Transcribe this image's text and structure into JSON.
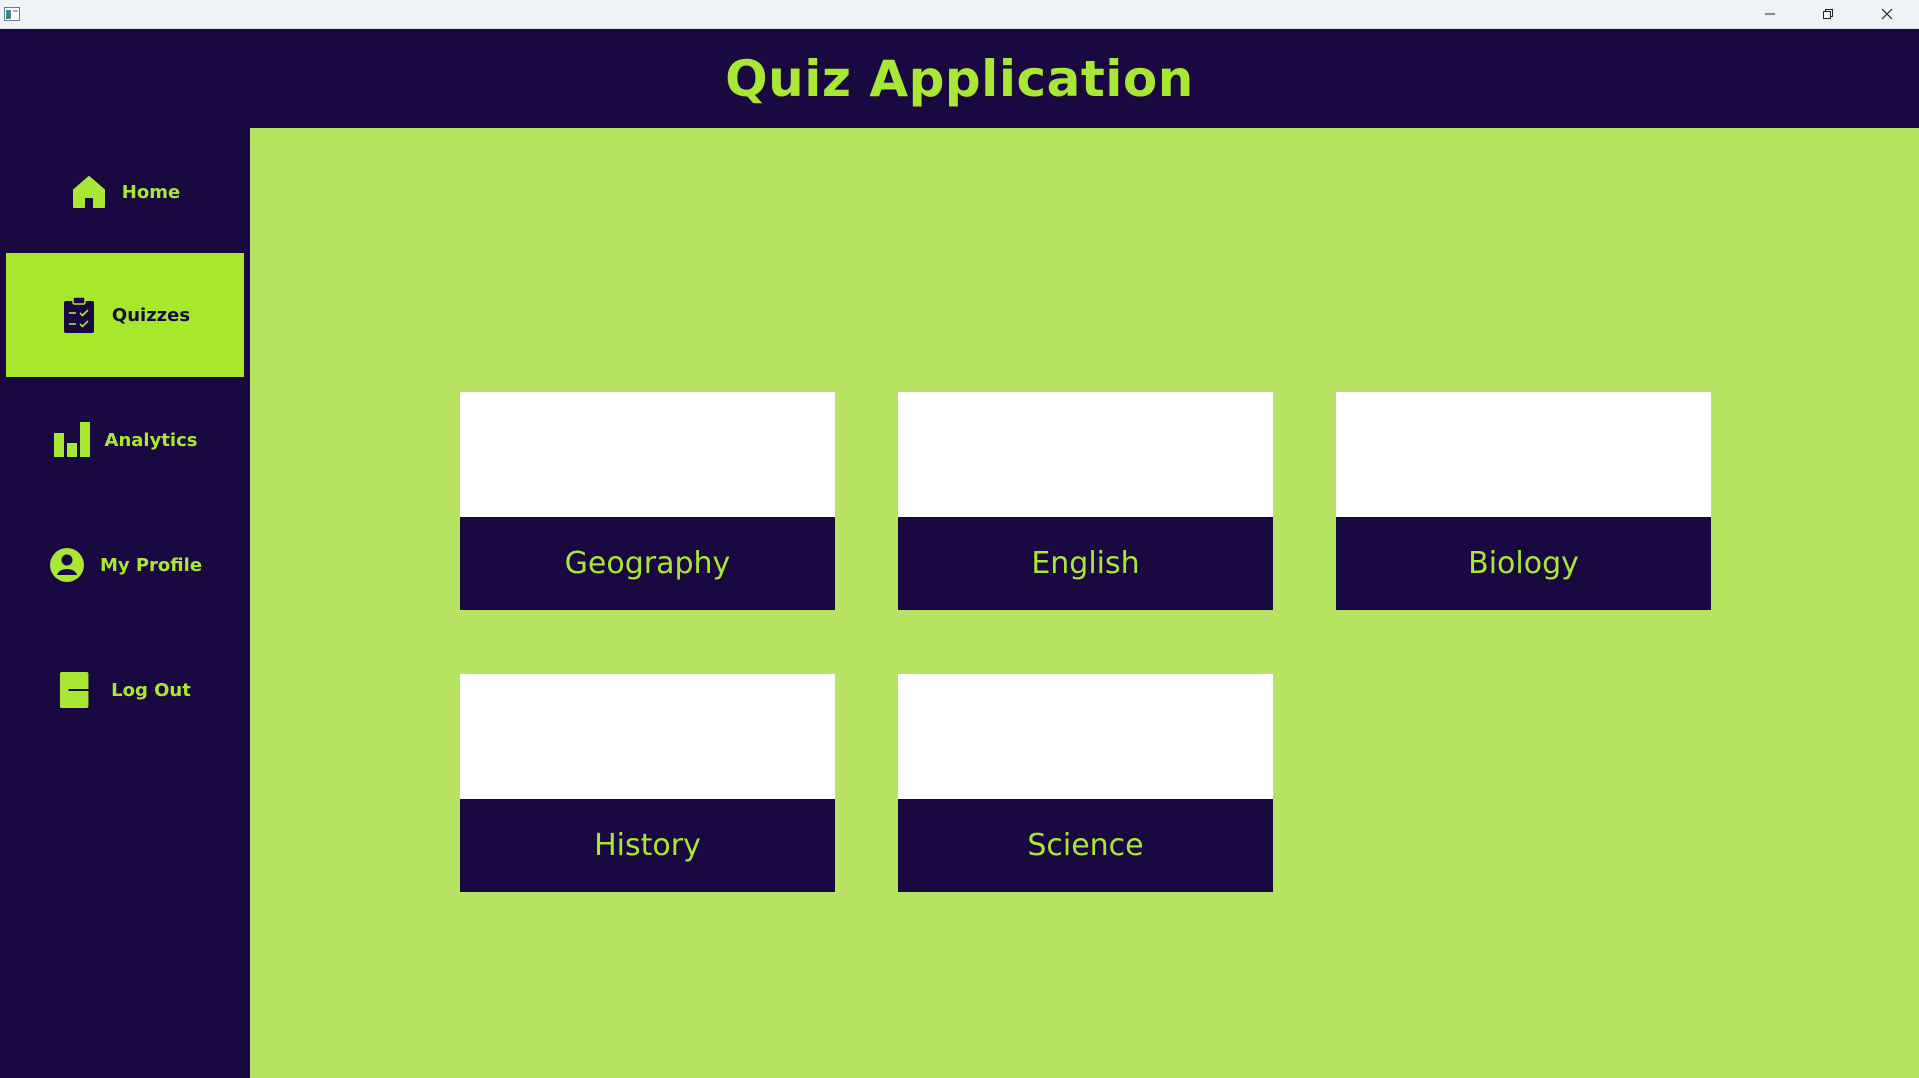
{
  "colors": {
    "dark": "#1a0840",
    "accent": "#a8e834",
    "content_bg": "#b6e462",
    "active_nav_bg": "#a8e82c",
    "card_image_bg": "#ffffff"
  },
  "window": {
    "controls": [
      "minimize",
      "restore",
      "close"
    ]
  },
  "header": {
    "title": "Quiz Application"
  },
  "sidebar": {
    "items": [
      {
        "label": "Home",
        "icon": "home-icon",
        "active": false
      },
      {
        "label": "Quizzes",
        "icon": "clipboard-checklist-icon",
        "active": true
      },
      {
        "label": "Analytics",
        "icon": "bar-chart-icon",
        "active": false
      },
      {
        "label": "My Profile",
        "icon": "user-circle-icon",
        "active": false
      },
      {
        "label": "Log Out",
        "icon": "logout-icon",
        "active": false
      }
    ]
  },
  "quizzes": [
    {
      "label": "Geography"
    },
    {
      "label": "English"
    },
    {
      "label": "Biology"
    },
    {
      "label": "History"
    },
    {
      "label": "Science"
    }
  ]
}
